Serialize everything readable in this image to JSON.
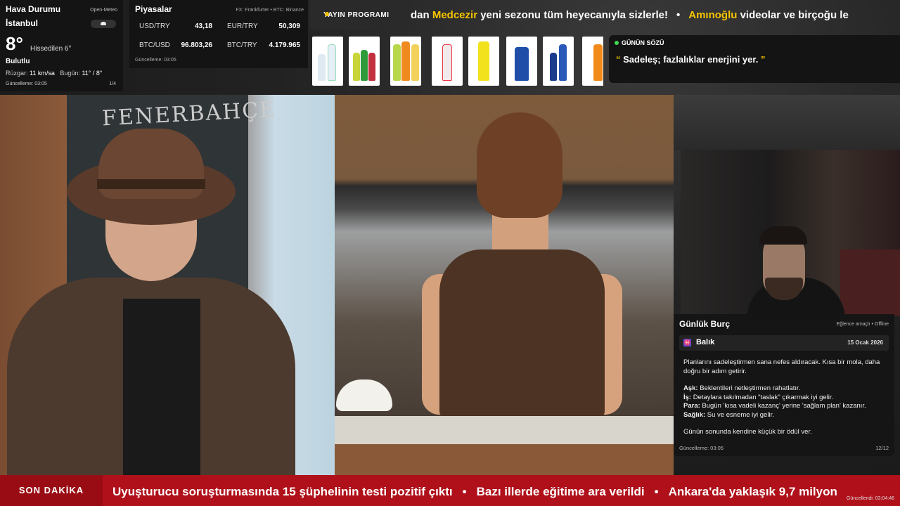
{
  "weather": {
    "title": "Hava Durumu",
    "source": "Open-Meteo",
    "city": "İstanbul",
    "temp": "8°",
    "feels_like": "Hissedilen 6°",
    "condition": "Bulutlu",
    "wind_label": "Rüzgar:",
    "wind_value": "11 km/sa",
    "today_label": "Bugün:",
    "today_value": "11° / 8°",
    "updated": "Güncelleme: 03:05",
    "page": "1/4",
    "icon": "cloud-icon"
  },
  "markets": {
    "title": "Piyasalar",
    "source": "FX: Frankfurter • BTC: Binance",
    "rates": [
      {
        "pair": "USD/TRY",
        "value": "43,18"
      },
      {
        "pair": "EUR/TRY",
        "value": "50,309"
      },
      {
        "pair": "BTC/USD",
        "value": "96.803,26"
      },
      {
        "pair": "BTC/TRY",
        "value": "4.179.965"
      }
    ],
    "updated": "Güncelleme: 03:05"
  },
  "schedule_button": "YAYIN PROGRAMI",
  "top_ticker": {
    "segments": [
      {
        "text": "dan ",
        "hl": false
      },
      {
        "text": "Medcezir",
        "hl": true
      },
      {
        "text": " yeni sezonu tüm heyecanıyla sizlerle!",
        "hl": false
      },
      {
        "text": "Amınoğlu",
        "hl": true
      },
      {
        "text": " videolar ve birçoğu le",
        "hl": false
      }
    ],
    "separator": "•"
  },
  "quote": {
    "label": "GÜNÜN SÖZÜ",
    "open_mark": "“",
    "text": "Sadeleş; fazlalıklar enerjini yer.",
    "close_mark": "”"
  },
  "horoscope": {
    "title": "Günlük Burç",
    "mode": "Eğlence amaçlı • Offline",
    "sign_icon": "♓",
    "sign": "Balık",
    "date": "15 Ocak 2026",
    "intro": "Planlarını sadeleştirmen sana nefes aldıracak. Kısa bir mola, daha doğru bir adım getirir.",
    "items": [
      {
        "label": "Aşk:",
        "text": " Beklentileri netleştirmen rahatlatır."
      },
      {
        "label": "İş:",
        "text": " Detaylara takılmadan \"taslak\" çıkarmak iyi gelir."
      },
      {
        "label": "Para:",
        "text": " Bugün 'kısa vadeli kazanç' yerine 'sağlam plan' kazanır."
      },
      {
        "label": "Sağlık:",
        "text": " Su ve esneme iyi gelir."
      }
    ],
    "outro": "Günün sonunda kendine küçük bir ödül ver.",
    "updated": "Güncelleme: 03:05",
    "page": "12/12"
  },
  "video": {
    "chalkboard_text": "FENERBAHÇE"
  },
  "breaking": {
    "label": "SON DAKİKA",
    "items": [
      "Uyuşturucu soruşturmasında 15 şüphelinin testi pozitif çıktı",
      "Bazı illerde eğitime ara verildi",
      "Ankara'da yaklaşık 9,7 milyon"
    ],
    "separator": "•",
    "updated": "Güncellendi: 03:04:46"
  },
  "colors": {
    "accent_yellow": "#f5c400",
    "breaking_red": "#b0101a",
    "live_green": "#3fd64f"
  }
}
